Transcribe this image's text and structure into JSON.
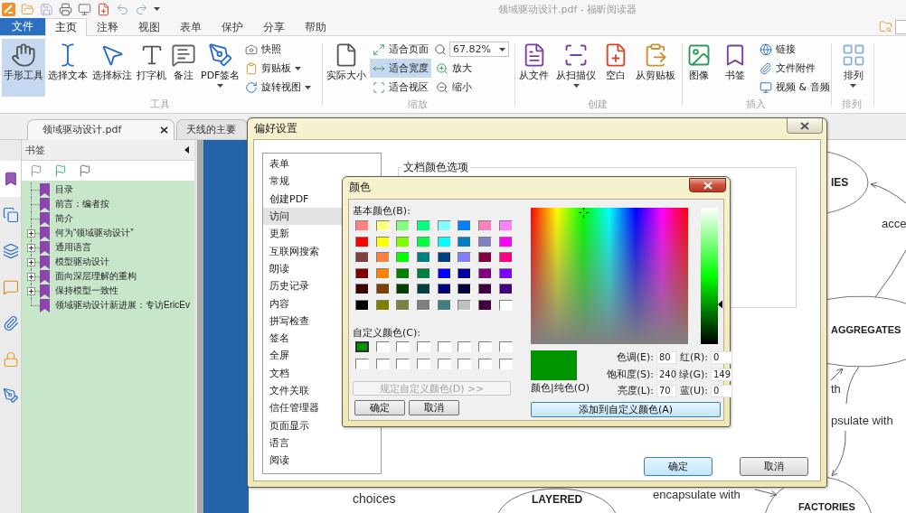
{
  "title_bar": {
    "title": "领域驱动设计.pdf - 福昕阅读器"
  },
  "menu": {
    "file_button": "文件",
    "tabs": [
      {
        "label": "主页",
        "selected": true
      },
      {
        "label": "注释",
        "selected": false
      },
      {
        "label": "视图",
        "selected": false
      },
      {
        "label": "表单",
        "selected": false
      },
      {
        "label": "保护",
        "selected": false
      },
      {
        "label": "分享",
        "selected": false
      },
      {
        "label": "帮助",
        "selected": false
      }
    ]
  },
  "ribbon": {
    "groups": [
      {
        "label": "工具",
        "items": [
          {
            "kind": "large",
            "label": "手形工具",
            "selected": true
          },
          {
            "kind": "large",
            "label": "选择文本",
            "selected": false
          },
          {
            "kind": "large",
            "label": "选择标注",
            "selected": false
          },
          {
            "kind": "large",
            "label": "打字机",
            "selected": false
          },
          {
            "kind": "large",
            "label": "备注",
            "selected": false
          },
          {
            "kind": "large",
            "label": "PDF签名",
            "selected": false,
            "dropdown": true
          },
          {
            "kind": "column",
            "items": [
              {
                "kind": "small",
                "label": "快照",
                "selected": false
              },
              {
                "kind": "small",
                "label": "剪贴板",
                "selected": false,
                "dropdown": true
              },
              {
                "kind": "small",
                "label": "旋转视图",
                "selected": false,
                "dropdown": true
              }
            ]
          }
        ]
      },
      {
        "label": "缩放",
        "items": [
          {
            "kind": "large",
            "label": "实际大小",
            "selected": false
          },
          {
            "kind": "column",
            "items": [
              {
                "kind": "small",
                "label": "适合页面",
                "selected": false
              },
              {
                "kind": "small",
                "label": "适合宽度",
                "selected": true
              },
              {
                "kind": "small",
                "label": "适合视区",
                "selected": false
              }
            ]
          },
          {
            "kind": "column",
            "items": [
              {
                "kind": "combo",
                "value": "67.82%"
              },
              {
                "kind": "small",
                "label": "放大",
                "selected": false
              },
              {
                "kind": "small",
                "label": "缩小",
                "selected": false
              }
            ]
          }
        ]
      },
      {
        "label": "创建",
        "items": [
          {
            "kind": "large",
            "label": "从文件",
            "selected": false
          },
          {
            "kind": "large",
            "label": "从扫描仪",
            "selected": false,
            "dropdown": true
          },
          {
            "kind": "large",
            "label": "空白",
            "selected": false
          },
          {
            "kind": "large",
            "label": "从剪贴板",
            "selected": false
          }
        ]
      },
      {
        "label": "插入",
        "items": [
          {
            "kind": "large",
            "label": "图像",
            "selected": false
          },
          {
            "kind": "large",
            "label": "书签",
            "selected": false
          },
          {
            "kind": "column",
            "items": [
              {
                "kind": "small",
                "label": "链接",
                "selected": false
              },
              {
                "kind": "small",
                "label": "文件附件",
                "selected": false
              },
              {
                "kind": "small",
                "label": "视频 & 音频",
                "selected": false
              }
            ]
          }
        ]
      },
      {
        "label": "排列",
        "items": [
          {
            "kind": "large",
            "label": "排列",
            "selected": false,
            "dropdown": true
          }
        ]
      }
    ]
  },
  "document_tabs": [
    {
      "label": "领域驱动设计.pdf",
      "selected": true
    },
    {
      "label": "天线的主要",
      "selected": false
    }
  ],
  "side_strip": {
    "items": [
      {
        "selected": true
      },
      {
        "selected": false
      },
      {
        "selected": false
      },
      {
        "selected": false
      },
      {
        "selected": false
      },
      {
        "selected": false
      },
      {
        "selected": false
      }
    ]
  },
  "bookmarks": {
    "title": "书签",
    "items": [
      {
        "label": "目录",
        "kind": "leaf"
      },
      {
        "label": "前言：编者按",
        "kind": "leaf"
      },
      {
        "label": "简介",
        "kind": "leaf"
      },
      {
        "label": "何为“领域驱动设计”",
        "kind": "collapsed"
      },
      {
        "label": "通用语言",
        "kind": "collapsed"
      },
      {
        "label": "模型驱动设计",
        "kind": "collapsed"
      },
      {
        "label": "面向深层理解的重构",
        "kind": "collapsed"
      },
      {
        "label": "保持模型一致性",
        "kind": "collapsed"
      },
      {
        "label": "领域驱动设计新进展：专访EricEv",
        "kind": "leaf"
      }
    ]
  },
  "diagram": {
    "node_labels": [
      "IES",
      "AGGREGATES",
      "LAYERED",
      "FACTORIES"
    ],
    "edge_labels": [
      "acce",
      "th",
      "psulate with",
      "choices",
      "encapsulate with"
    ]
  },
  "preferences_dialog": {
    "title": "偏好设置",
    "categories": [
      {
        "label": "表单",
        "selected": false
      },
      {
        "label": "常规",
        "selected": false
      },
      {
        "label": "创建PDF",
        "selected": false
      },
      {
        "label": "访问",
        "selected": true
      },
      {
        "label": "更新",
        "selected": false
      },
      {
        "label": "互联网搜索",
        "selected": false
      },
      {
        "label": "朗读",
        "selected": false
      },
      {
        "label": "历史记录",
        "selected": false
      },
      {
        "label": "内容",
        "selected": false
      },
      {
        "label": "拼写检查",
        "selected": false
      },
      {
        "label": "签名",
        "selected": false
      },
      {
        "label": "全屏",
        "selected": false
      },
      {
        "label": "文档",
        "selected": false
      },
      {
        "label": "文件关联",
        "selected": false
      },
      {
        "label": "信任管理器",
        "selected": false
      },
      {
        "label": "页面显示",
        "selected": false
      },
      {
        "label": "语言",
        "selected": false
      },
      {
        "label": "阅读",
        "selected": false
      }
    ],
    "group_title": "文档颜色选项",
    "buttons": [
      {
        "label": "确定",
        "default": true
      },
      {
        "label": "取消",
        "default": false
      }
    ]
  },
  "color_dialog": {
    "title": "颜色",
    "basic_label": "基本颜色(B):",
    "basic_colors": [
      {
        "color": "#ff8080",
        "selected": false
      },
      {
        "color": "#ffff80",
        "selected": false
      },
      {
        "color": "#80ff80",
        "selected": false
      },
      {
        "color": "#00ff80",
        "selected": false
      },
      {
        "color": "#80ffff",
        "selected": false
      },
      {
        "color": "#0080ff",
        "selected": false
      },
      {
        "color": "#ff80c0",
        "selected": false
      },
      {
        "color": "#ff80ff",
        "selected": false
      },
      {
        "color": "#ff0000",
        "selected": false
      },
      {
        "color": "#ffff00",
        "selected": false
      },
      {
        "color": "#80ff00",
        "selected": false
      },
      {
        "color": "#00ff40",
        "selected": false
      },
      {
        "color": "#00ffff",
        "selected": false
      },
      {
        "color": "#0080c0",
        "selected": false
      },
      {
        "color": "#8080c0",
        "selected": false
      },
      {
        "color": "#ff00ff",
        "selected": false
      },
      {
        "color": "#804040",
        "selected": false
      },
      {
        "color": "#ff8040",
        "selected": false
      },
      {
        "color": "#00ff00",
        "selected": false
      },
      {
        "color": "#008080",
        "selected": false
      },
      {
        "color": "#004080",
        "selected": false
      },
      {
        "color": "#8080ff",
        "selected": false
      },
      {
        "color": "#800040",
        "selected": false
      },
      {
        "color": "#ff0080",
        "selected": false
      },
      {
        "color": "#800000",
        "selected": false
      },
      {
        "color": "#ff8000",
        "selected": false
      },
      {
        "color": "#008000",
        "selected": false
      },
      {
        "color": "#008040",
        "selected": false
      },
      {
        "color": "#0000ff",
        "selected": false
      },
      {
        "color": "#0000a0",
        "selected": false
      },
      {
        "color": "#800080",
        "selected": false
      },
      {
        "color": "#8000ff",
        "selected": false
      },
      {
        "color": "#400000",
        "selected": false
      },
      {
        "color": "#804000",
        "selected": false
      },
      {
        "color": "#004000",
        "selected": false
      },
      {
        "color": "#004040",
        "selected": false
      },
      {
        "color": "#000080",
        "selected": false
      },
      {
        "color": "#000040",
        "selected": false
      },
      {
        "color": "#400040",
        "selected": false
      },
      {
        "color": "#400080",
        "selected": false
      },
      {
        "color": "#000000",
        "selected": false
      },
      {
        "color": "#808000",
        "selected": false
      },
      {
        "color": "#808040",
        "selected": false
      },
      {
        "color": "#808080",
        "selected": false
      },
      {
        "color": "#408080",
        "selected": false
      },
      {
        "color": "#c0c0c0",
        "selected": false
      },
      {
        "color": "#400040",
        "selected": false
      },
      {
        "color": "#ffffff",
        "selected": false
      }
    ],
    "custom_label": "自定义颜色(C):",
    "custom_colors": [
      {
        "color": "#009500",
        "selected": true
      },
      {
        "color": "#ffffff",
        "selected": false
      },
      {
        "color": "#ffffff",
        "selected": false
      },
      {
        "color": "#ffffff",
        "selected": false
      },
      {
        "color": "#ffffff",
        "selected": false
      },
      {
        "color": "#ffffff",
        "selected": false
      },
      {
        "color": "#ffffff",
        "selected": false
      },
      {
        "color": "#ffffff",
        "selected": false
      },
      {
        "color": "#ffffff",
        "selected": false
      },
      {
        "color": "#ffffff",
        "selected": false
      },
      {
        "color": "#ffffff",
        "selected": false
      },
      {
        "color": "#ffffff",
        "selected": false
      },
      {
        "color": "#ffffff",
        "selected": false
      },
      {
        "color": "#ffffff",
        "selected": false
      },
      {
        "color": "#ffffff",
        "selected": false
      },
      {
        "color": "#ffffff",
        "selected": false
      }
    ],
    "define_button": {
      "label": "规定自定义颜色(D) >>",
      "disabled": true
    },
    "buttons": [
      {
        "label": "确定"
      },
      {
        "label": "取消"
      }
    ],
    "luminance": {
      "level": 0.29
    },
    "preview_label": "颜色|纯色(O)",
    "fields": [
      {
        "label": "色调(E):",
        "value": "80"
      },
      {
        "label": "红(R):",
        "value": "0"
      },
      {
        "label": "饱和度(S):",
        "value": "240"
      },
      {
        "label": "绿(G):",
        "value": "149"
      },
      {
        "label": "亮度(L):",
        "value": "70"
      },
      {
        "label": "蓝(U):",
        "value": "0"
      }
    ],
    "add_button": "添加到自定义颜色(A)"
  }
}
